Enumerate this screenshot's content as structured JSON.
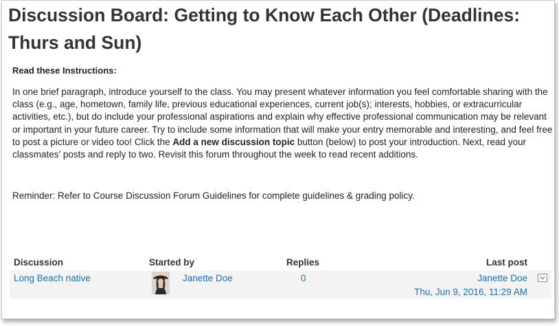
{
  "page": {
    "title": "Discussion Board: Getting to Know Each Other (Deadlines: Thurs and Sun)"
  },
  "instructions": {
    "heading": "Read these Instructions:",
    "paragraph_before_bold": "In one brief paragraph, introduce yourself to the class. You may present whatever information you feel comfortable sharing with the class (e.g., age, hometown, family life, previous educational experiences, current job(s); interests, hobbies, or extracurricular activities, etc.), but do include your professional aspirations and explain why effective professional communication may be relevant or important in your future career. Try to include some information that will make your entry memorable and interesting, and feel free to post a picture or video too!  Click the ",
    "paragraph_bold": "Add a new discussion topic",
    "paragraph_after_bold": " button (below)  to post your introduction. Next, read your classmates' posts and reply to two. Revisit this forum throughout the week to read recent additions.",
    "reminder": "Reminder: Refer to Course Discussion Forum Guidelines  for complete guidelines & grading policy."
  },
  "table": {
    "headers": {
      "discussion": "Discussion",
      "started_by": "Started by",
      "replies": "Replies",
      "last_post": "Last post"
    },
    "rows": [
      {
        "discussion": "Long Beach native",
        "started_by": "Janette Doe",
        "replies": "0",
        "last_post_author": "Janette Doe",
        "last_post_date": "Thu, Jun 9, 2016, 11:29 AM"
      }
    ]
  },
  "icons": {
    "avatar": "user-avatar-photo",
    "row_menu": "dropdown-toggle-icon"
  },
  "colors": {
    "link": "#1f6fb5",
    "text": "#222222",
    "row_background": "#f3f3f3"
  }
}
